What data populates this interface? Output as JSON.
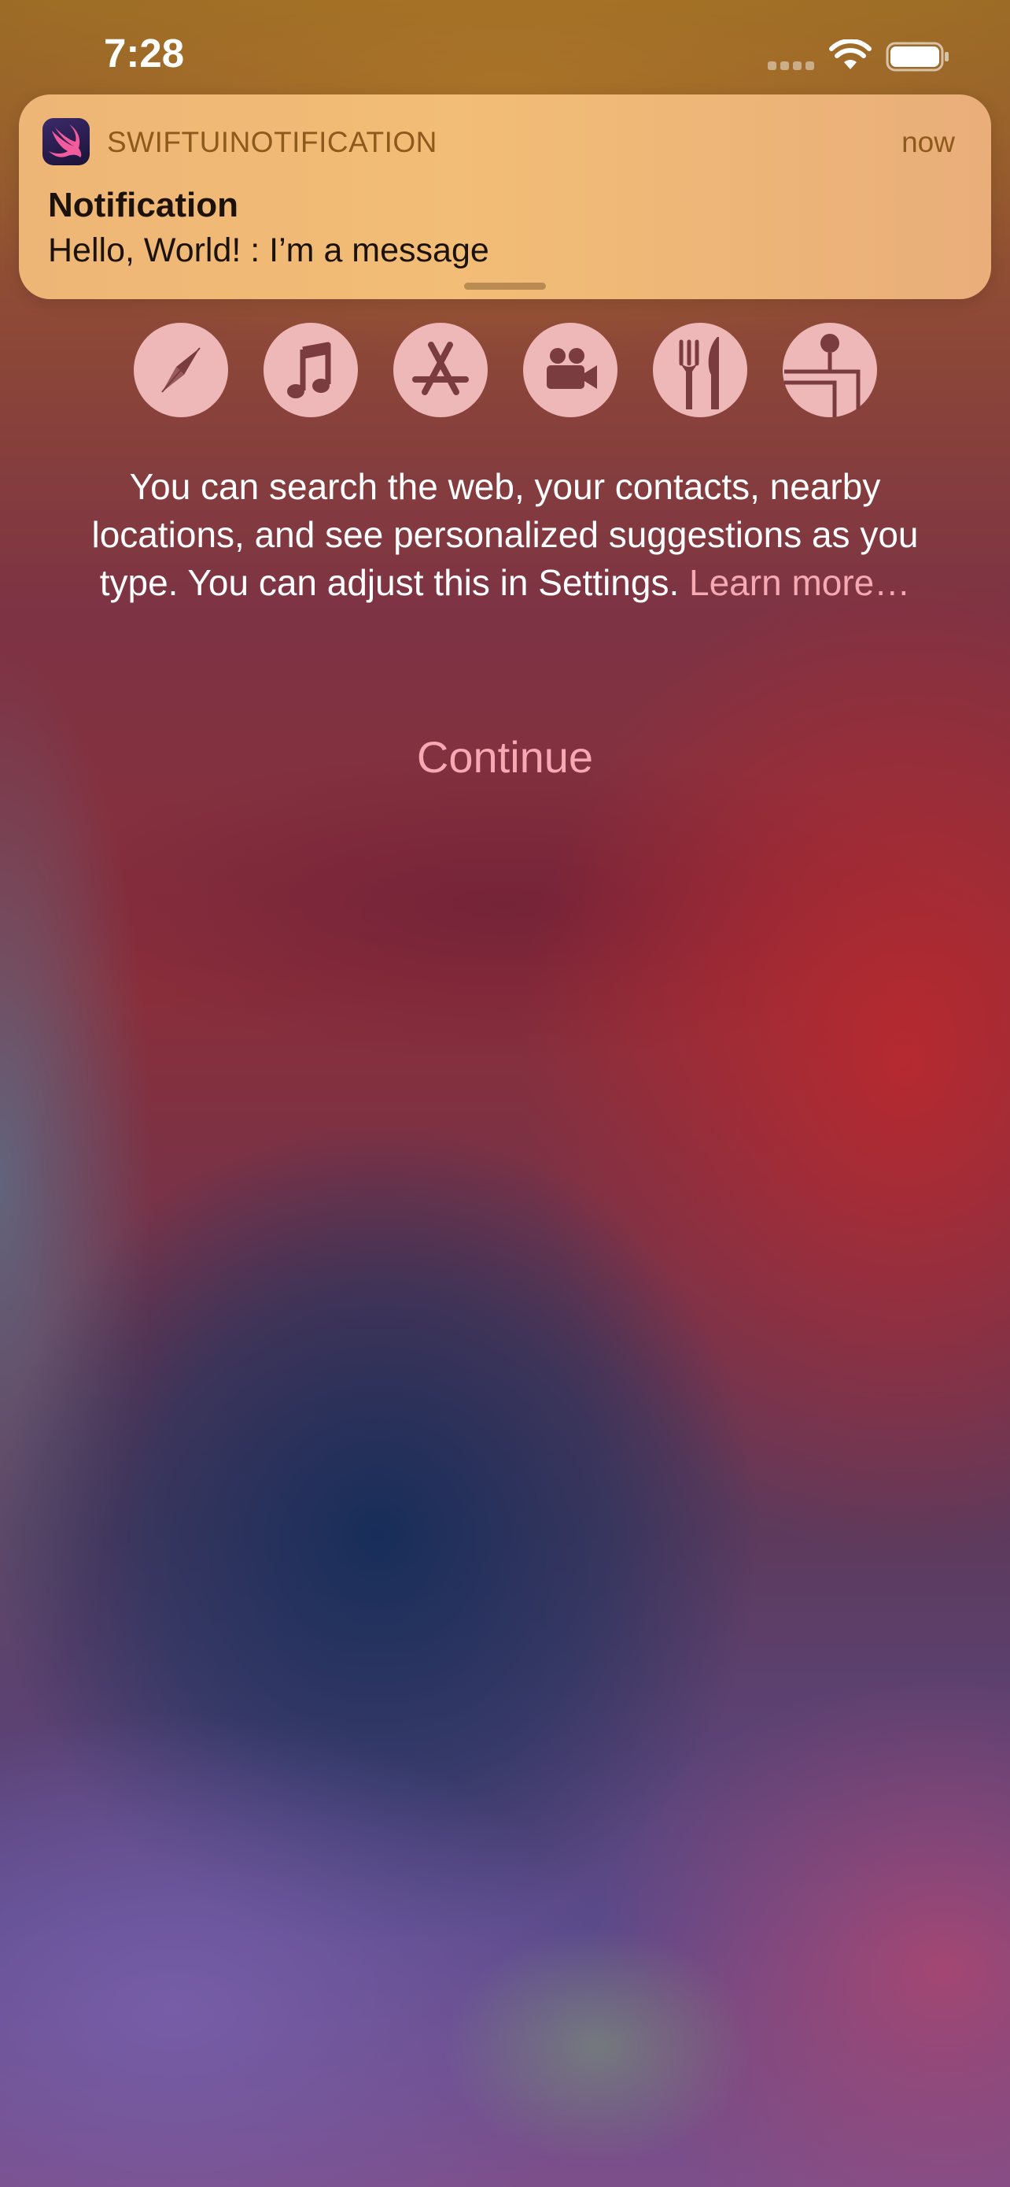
{
  "status_bar": {
    "time": "7:28"
  },
  "notification": {
    "app_name": "SWIFTUINOTIFICATION",
    "time": "now",
    "title": "Notification",
    "body": "Hello, World! : I’m a message"
  },
  "feature_icons": [
    {
      "icon": "safari-compass-icon"
    },
    {
      "icon": "music-note-icon"
    },
    {
      "icon": "app-store-icon"
    },
    {
      "icon": "movie-camera-icon"
    },
    {
      "icon": "fork-knife-icon"
    },
    {
      "icon": "map-pin-icon"
    }
  ],
  "description": {
    "text": "You can search the web, your contacts, nearby locations, and see personalized suggestions as you type. You can adjust this in Settings.",
    "link": "Learn more…"
  },
  "continue_label": "Continue",
  "colors": {
    "accent_pink": "#f6a8b3",
    "icon_circle": "#efb8b8",
    "icon_glyph": "#7a3c3e",
    "banner": "#f2bd76",
    "banner_app_name": "#8d5a1c"
  }
}
